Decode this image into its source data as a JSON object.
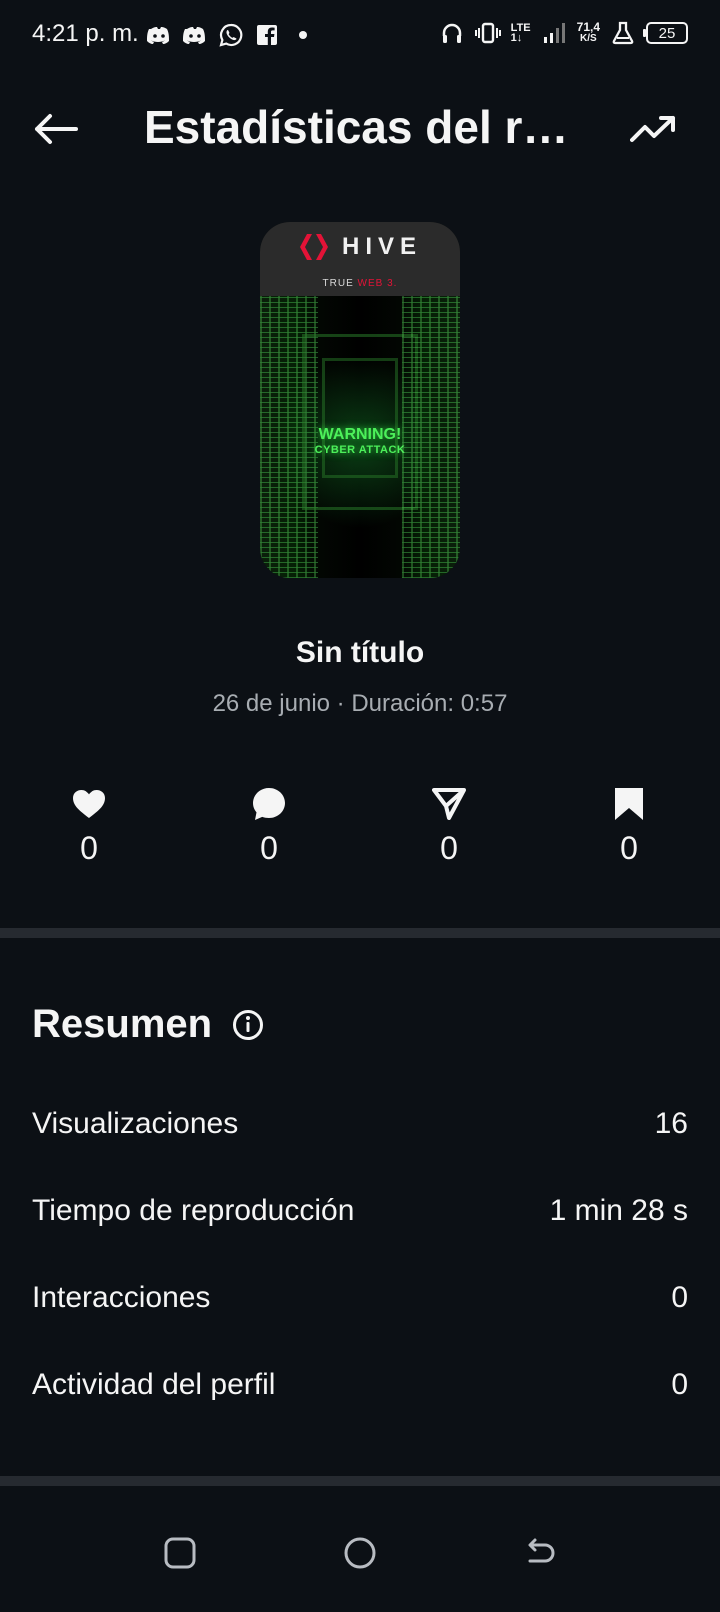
{
  "status_bar": {
    "time": "4:21 p. m.",
    "network": "LTE",
    "network_sub": "1↓",
    "speed_value": "71,4",
    "speed_unit": "K/S",
    "battery": "25",
    "left_icons": [
      "discord-icon",
      "discord-icon",
      "whatsapp-icon",
      "facebook-icon",
      "dot-icon"
    ],
    "right_icons": [
      "headphones-icon",
      "vibrate-icon",
      "signal-icon",
      "lab-icon",
      "battery-icon"
    ]
  },
  "header": {
    "title": "Estadísticas del re...",
    "back_icon": "arrow-left-icon",
    "trend_icon": "trend-up-icon"
  },
  "thumbnail": {
    "brand": "HIVE",
    "tagline_prefix": "TRUE ",
    "tagline_highlight": "WEB 3.",
    "warning_line1": "WARNING!",
    "warning_line2": "CYBER ATTACK",
    "brand_color": "#e31337"
  },
  "reel": {
    "title": "Sin título",
    "meta": "26 de junio · Duración: 0:57"
  },
  "engagement": {
    "likes": "0",
    "comments": "0",
    "shares": "0",
    "saves": "0"
  },
  "summary": {
    "title": "Resumen",
    "rows": [
      {
        "label": "Visualizaciones",
        "value": "16"
      },
      {
        "label": "Tiempo de reproducción",
        "value": "1 min 28 s"
      },
      {
        "label": "Interacciones",
        "value": "0"
      },
      {
        "label": "Actividad del perfil",
        "value": "0"
      }
    ]
  },
  "navigation": {
    "recent_icon": "recent-apps-icon",
    "home_icon": "home-icon",
    "back_icon": "back-icon"
  }
}
